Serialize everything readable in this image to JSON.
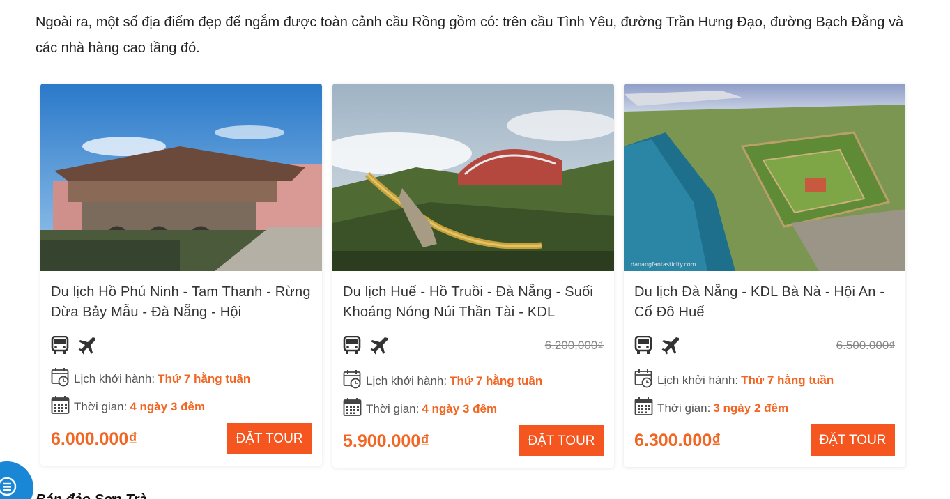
{
  "article": {
    "intro": "Ngoài ra, một số địa điểm đẹp để ngắm được toàn cảnh cầu Rồng gồm có: trên cầu Tình Yêu, đường Trần Hưng Đạo, đường Bạch Đằng và các nhà hàng cao tầng đó.",
    "next_heading": "Bán đảo Sơn Trà"
  },
  "labels": {
    "departure": "Lịch khởi hành:",
    "duration": "Thời gian:",
    "book": "ĐẶT TOUR"
  },
  "tours": [
    {
      "title": "Du lịch Hồ Phú Ninh - Tam Thanh - Rừng Dừa Bảy Mẫu - Đà Nẵng - Hội",
      "old_price": "",
      "departure": "Thứ 7 hằng tuần",
      "duration": "4 ngày 3 đêm",
      "price": "6.000.000₫",
      "image": "japanese-covered-bridge-hoi-an"
    },
    {
      "title": "Du lịch Huế - Hồ Truồi - Đà Nẵng - Suối Khoáng Nóng Núi Thần Tài - KDL",
      "old_price": "6.200.000₫",
      "departure": "Thứ 7 hằng tuần",
      "duration": "4 ngày 3 đêm",
      "price": "5.900.000₫",
      "image": "golden-bridge-ba-na-hills"
    },
    {
      "title": "Du lịch Đà Nẵng - KDL Bà Nà - Hội An - Cố Đô Huế",
      "old_price": "6.500.000₫",
      "departure": "Thứ 7 hằng tuần",
      "duration": "3 ngày 2 đêm",
      "price": "6.300.000₫",
      "image": "hue-citadel-aerial",
      "watermark": "danangfantasticity.com"
    }
  ],
  "icons": {
    "transport": [
      "bus-icon",
      "plane-icon"
    ],
    "departure": "calendar-clock-icon",
    "duration": "calendar-icon",
    "fab": "menu-icon"
  },
  "colors": {
    "accent": "#f26522",
    "button": "#f5561f",
    "fab": "#1a87d6"
  }
}
